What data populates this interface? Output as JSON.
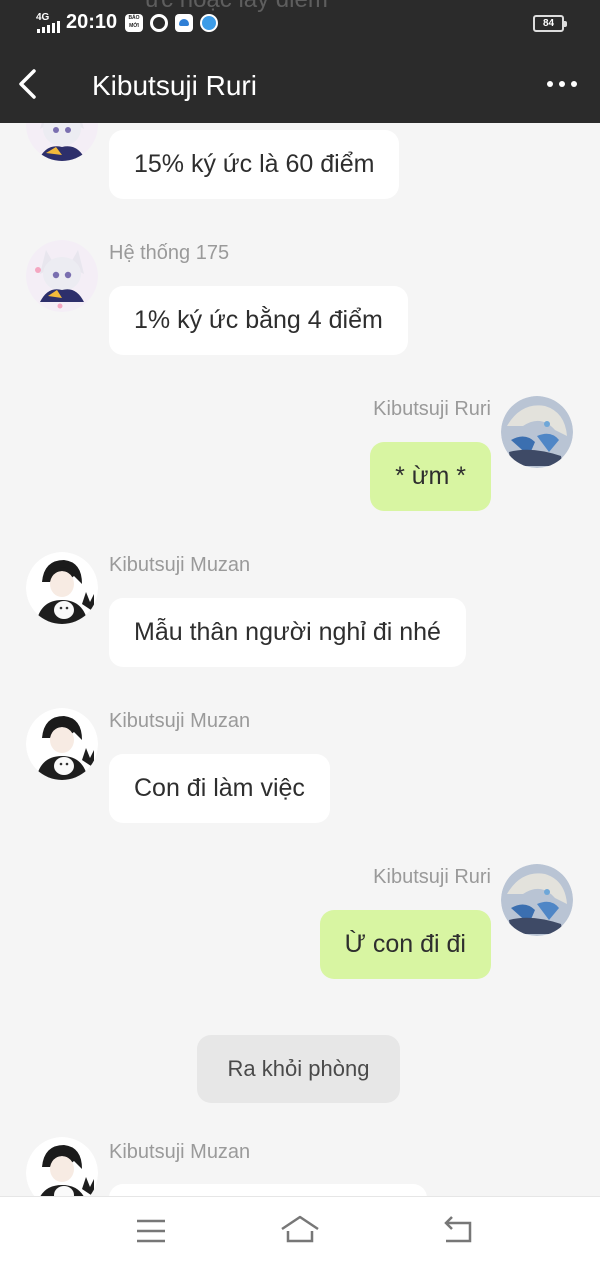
{
  "status_bar": {
    "network": "4G",
    "time": "20:10",
    "news_icon_text": "BÁO MỚI",
    "battery": "84"
  },
  "header": {
    "ghost_text": "ức hoặc lấy điểm",
    "title": "Kibutsuji Ruri",
    "back_icon": "chevron-left-icon",
    "more_icon": "more-dots-icon",
    "background": "#2b2b2b"
  },
  "messages": [
    {
      "sender": "",
      "text": "15% ký ức là 60 điểm",
      "side": "left",
      "avatar": "cat-girl-avatar"
    },
    {
      "sender": "Hệ thống 175",
      "text": "1% ký ức bằng 4 điểm",
      "side": "left",
      "avatar": "cat-girl-avatar"
    },
    {
      "sender": "Kibutsuji Ruri",
      "text": "* ừm *",
      "side": "right",
      "avatar": "blue-haired-girl-avatar"
    },
    {
      "sender": "Kibutsuji Muzan",
      "text": "Mẫu thân người nghỉ đi nhé",
      "side": "left",
      "avatar": "dark-haired-boy-avatar"
    },
    {
      "sender": "Kibutsuji Muzan",
      "text": "Con đi làm việc",
      "side": "left",
      "avatar": "dark-haired-boy-avatar"
    },
    {
      "sender": "Kibutsuji Ruri",
      "text": "Ừ con đi đi",
      "side": "right",
      "avatar": "blue-haired-girl-avatar"
    },
    {
      "sender": "Kibutsuji Muzan",
      "text": "",
      "side": "left",
      "avatar": "dark-haired-boy-avatar"
    }
  ],
  "system_notice": "Ra khỏi phòng",
  "colors": {
    "my_bubble": "#d8f5a2",
    "other_bubble": "#ffffff",
    "page_background": "#f5f5f5",
    "sender_name": "#9a9a9a"
  },
  "nav": {
    "menu_icon": "menu-icon",
    "home_icon": "home-icon",
    "back_icon": "back-arrow-icon"
  }
}
